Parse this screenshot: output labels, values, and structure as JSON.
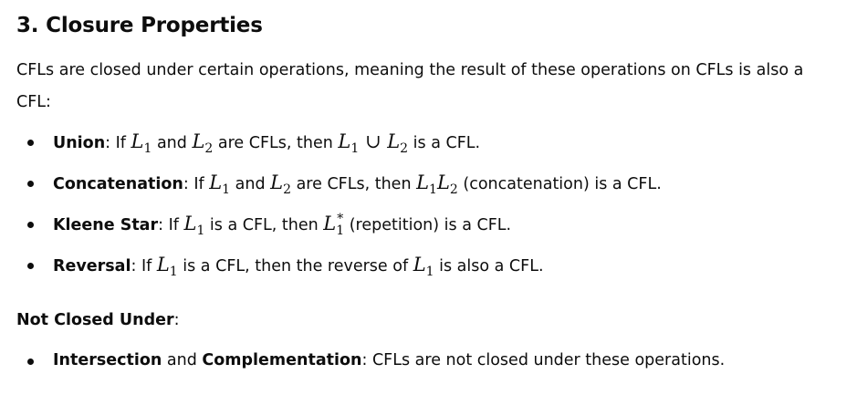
{
  "heading": "3. Closure Properties",
  "intro": "CFLs are closed under certain operations, meaning the result of these operations on CFLs is also a CFL:",
  "properties": [
    {
      "term": "Union",
      "t1": ": If ",
      "m1": "L",
      "m1sub": "1",
      "t2": " and ",
      "m2": "L",
      "m2sub": "2",
      "t3": " are CFLs, then ",
      "m3a": "L",
      "m3asub": "1",
      "m3op": " ∪ ",
      "m3b": "L",
      "m3bsub": "2",
      "t4": " is a CFL."
    },
    {
      "term": "Concatenation",
      "t1": ": If ",
      "m1": "L",
      "m1sub": "1",
      "t2": " and ",
      "m2": "L",
      "m2sub": "2",
      "t3": " are CFLs, then ",
      "m3a": "L",
      "m3asub": "1",
      "m3b": "L",
      "m3bsub": "2",
      "t4": " (concatenation) is a CFL."
    },
    {
      "term": "Kleene Star",
      "t1": ": If ",
      "m1": "L",
      "m1sub": "1",
      "t2": " is a CFL, then ",
      "m2": "L",
      "m2sub": "1",
      "m2sup": "*",
      "t3": " (repetition) is a CFL."
    },
    {
      "term": "Reversal",
      "t1": ": If ",
      "m1": "L",
      "m1sub": "1",
      "t2": " is a CFL, then the reverse of ",
      "m2": "L",
      "m2sub": "1",
      "t3": " is also a CFL."
    }
  ],
  "not_closed_label": "Not Closed Under",
  "not_closed_colon": ":",
  "not_closed_item": {
    "term1": "Intersection",
    "mid": " and ",
    "term2": "Complementation",
    "rest": ": CFLs are not closed under these operations."
  }
}
